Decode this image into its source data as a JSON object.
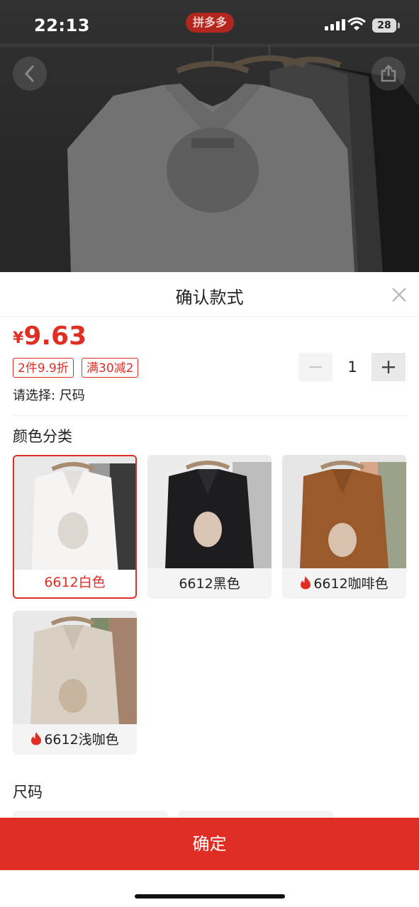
{
  "status_bar": {
    "time": "22:13",
    "app_badge": "拼多多",
    "battery": "28"
  },
  "sheet": {
    "title": "确认款式",
    "price": {
      "currency": "¥",
      "amount": "9.63"
    },
    "tags": [
      "2件9.9折",
      "满30减2"
    ],
    "select_hint": "请选择: 尺码",
    "quantity": "1",
    "color_section_title": "颜色分类",
    "colors": [
      {
        "label": "6612白色",
        "hot": false,
        "selected": true,
        "shirt_color": "#f3f1ee"
      },
      {
        "label": "6612黑色",
        "hot": false,
        "selected": false,
        "shirt_color": "#1c1c1e"
      },
      {
        "label": "6612咖啡色",
        "hot": true,
        "selected": false,
        "shirt_color": "#9a5a2c"
      },
      {
        "label": "6612浅咖色",
        "hot": true,
        "selected": false,
        "shirt_color": "#d8d0c3"
      }
    ],
    "size_section_title": "尺码",
    "confirm_label": "确定"
  },
  "icons": {
    "back": "chevron-left-icon",
    "share": "share-icon",
    "close": "close-icon",
    "minus": "minus-icon",
    "plus": "plus-icon",
    "hot": "fire-icon"
  },
  "colors": {
    "accent": "#e02e24",
    "chip_bg": "#f4f4f4"
  }
}
